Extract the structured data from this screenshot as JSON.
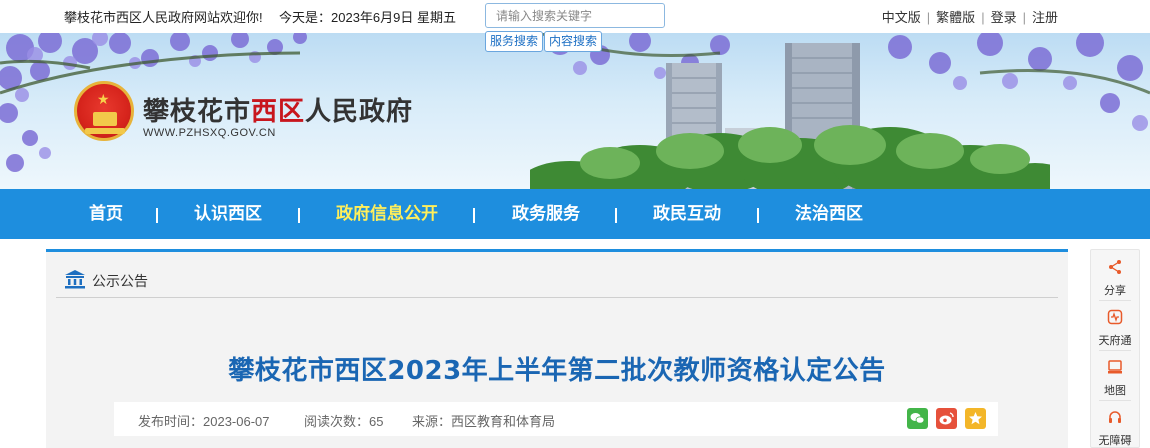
{
  "topbar": {
    "welcome": "攀枝花市西区人民政府网站欢迎你!",
    "today_label": "今天是：",
    "date": "2023年6月9日",
    "weekday": "星期五",
    "search": {
      "placeholder": "请输入搜索关键字",
      "service_search": "服务搜索",
      "content_search": "内容搜索"
    },
    "links": [
      "中文版",
      "繁體版",
      "登录",
      "注册"
    ]
  },
  "header": {
    "title_part1": "攀枝花市",
    "title_part2": "西区",
    "title_part3": "人民政府",
    "url": "WWW.PZHSXQ.GOV.CN"
  },
  "nav": {
    "items": [
      "首页",
      "认识西区",
      "政府信息公开",
      "政务服务",
      "政民互动",
      "法治西区"
    ],
    "active": "政府信息公开"
  },
  "breadcrumb": {
    "label": "公示公告"
  },
  "article": {
    "title": "攀枝花市西区2023年上半年第二批次教师资格认定公告",
    "publish_label": "发布时间：",
    "publish_date": "2023-06-07",
    "views_label": "阅读次数：",
    "views": "65",
    "source_label": "来源：",
    "source": "西区教育和体育局"
  },
  "share_icons": [
    "wechat-icon",
    "weibo-icon",
    "favorite-icon"
  ],
  "rightbar": {
    "items": [
      {
        "label": "分享",
        "icon": "share-icon"
      },
      {
        "label": "天府通",
        "icon": "tianfutong-icon"
      },
      {
        "label": "地图",
        "icon": "map-icon"
      },
      {
        "label": "无障碍",
        "icon": "accessibility-icon"
      }
    ]
  },
  "colors": {
    "nav_bg": "#1e8ede",
    "nav_active": "#ffef5b",
    "title_blue": "#1a66b3",
    "accent_red": "#c8161d",
    "wechat": "#43b549",
    "weibo": "#e6513b",
    "favorite": "#f3b629"
  }
}
